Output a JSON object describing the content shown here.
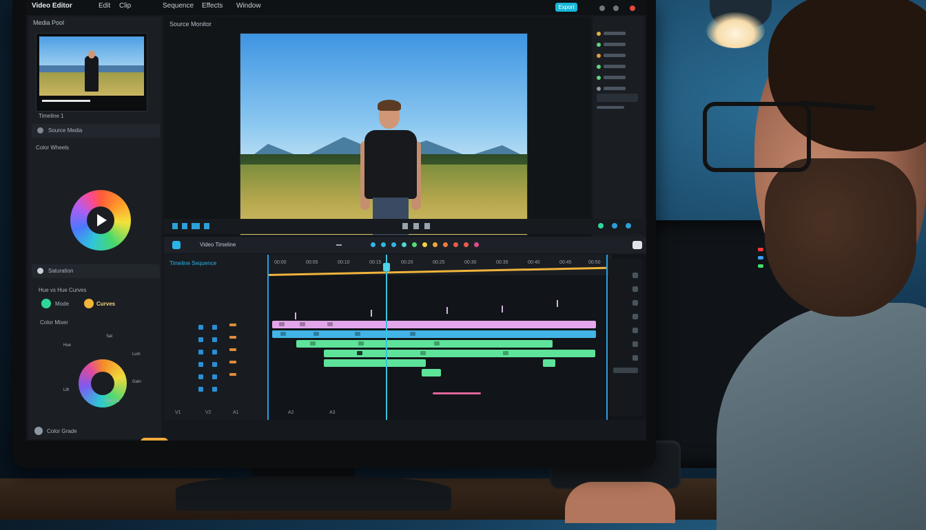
{
  "menubar": {
    "app_title": "Video Editor",
    "items": [
      "Edit",
      "Clip",
      "Sequence",
      "Effects",
      "Window"
    ],
    "export_label": "Export"
  },
  "media_panel": {
    "header": "Media Pool",
    "clip_label": "Timeline 1",
    "row1": "Source Media",
    "section": "Color Wheels"
  },
  "color_panel": {
    "row": "Saturation",
    "section_label": "Hue vs Hue Curves",
    "toggle1": "Mode",
    "toggle2": "Curves",
    "sub_section": "Color Mixer",
    "bottom_label": "Color Grade",
    "wheel_labels": [
      "Hue",
      "Sat",
      "Lum",
      "Gain",
      "Gamma",
      "Lift"
    ]
  },
  "viewer": {
    "title": "Source Monitor"
  },
  "toolbar": {
    "timeline_label": "Video Timeline"
  },
  "timeline": {
    "header": "Timeline Sequence",
    "ruler": [
      "00:00",
      "00:05",
      "00:10",
      "00:15",
      "00:20",
      "00:25",
      "00:30",
      "00:35",
      "00:40",
      "00:45",
      "00:50"
    ],
    "bottom_labels": [
      "V1",
      "V2",
      "A1",
      "A2",
      "A3"
    ]
  },
  "colors": {
    "accent": "#19b7d8",
    "clip_pink": "#e4a6ea",
    "clip_blue": "#42b4e6",
    "clip_green": "#5ee39a",
    "playhead": "#38c2de",
    "yellow_track": "#f0b43a"
  }
}
